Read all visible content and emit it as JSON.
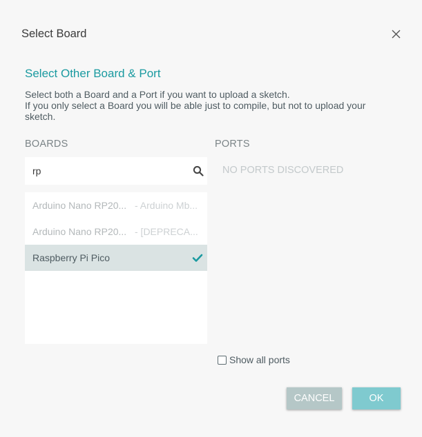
{
  "dialog": {
    "title": "Select Board",
    "subtitle": "Select Other Board & Port",
    "description_line1": "Select both a Board and a Port if you want to upload a sketch.",
    "description_line2": "If you only select a Board you will be able just to compile, but not to upload your sketch."
  },
  "boards": {
    "label": "BOARDS",
    "search_value": "rp",
    "items": [
      {
        "name": "Arduino Nano RP20...",
        "package": "- Arduino Mb..."
      },
      {
        "name": "Arduino Nano RP20...",
        "package": "- [DEPRECA..."
      },
      {
        "name": "Raspberry Pi Pico",
        "package": ""
      }
    ],
    "selected_index": 2
  },
  "ports": {
    "label": "PORTS",
    "empty_text": "NO PORTS DISCOVERED",
    "show_all_label": "Show all ports"
  },
  "buttons": {
    "cancel": "CANCEL",
    "ok": "OK"
  },
  "colors": {
    "accent": "#1a9aa0",
    "ok_button": "#7fcacf",
    "cancel_button": "#b5c7c7",
    "selected_row": "#dae3e3"
  }
}
